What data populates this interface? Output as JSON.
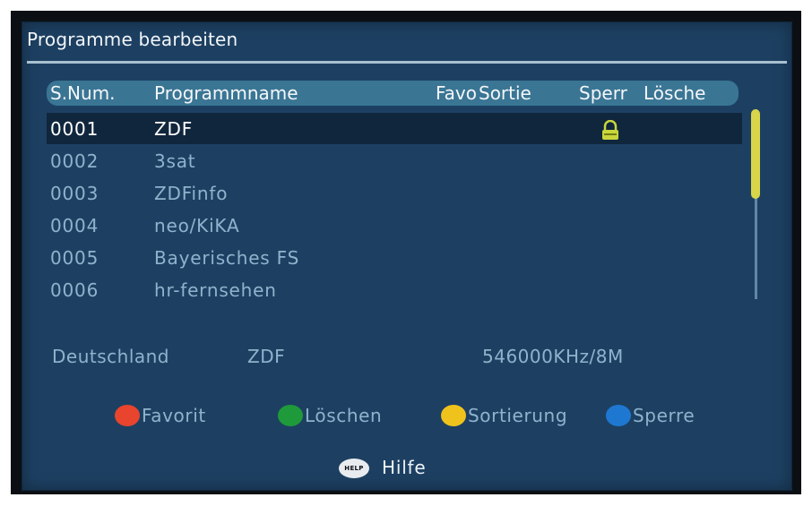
{
  "screen_title": "Programme bearbeiten",
  "columns": {
    "num": "S.Num.",
    "name": "Programmname",
    "favo": "Favo",
    "sortie": "Sortie",
    "sperr": "Sperr",
    "losche": "Lösche"
  },
  "channels": [
    {
      "num": "0001",
      "name": "ZDF",
      "locked": true,
      "selected": true
    },
    {
      "num": "0002",
      "name": "3sat",
      "locked": false,
      "selected": false
    },
    {
      "num": "0003",
      "name": "ZDFinfo",
      "locked": false,
      "selected": false
    },
    {
      "num": "0004",
      "name": "neo/KiKA",
      "locked": false,
      "selected": false
    },
    {
      "num": "0005",
      "name": "Bayerisches FS",
      "locked": false,
      "selected": false
    },
    {
      "num": "0006",
      "name": "hr-fernsehen",
      "locked": false,
      "selected": false
    }
  ],
  "info": {
    "country": "Deutschland",
    "provider": "ZDF",
    "frequency": "546000KHz/8M"
  },
  "legend": [
    {
      "label": "Favorit",
      "color": "#e8442e"
    },
    {
      "label": "Löschen",
      "color": "#1f9a3b"
    },
    {
      "label": "Sortierung",
      "color": "#f0c21c"
    },
    {
      "label": "Sperre",
      "color": "#1e78d2"
    }
  ],
  "help": {
    "button_text": "HELP",
    "label": "Hilfe"
  },
  "colors": {
    "background": "#1d4062",
    "header_bar": "#3a7594",
    "selected_row": "#10263d",
    "scroll_thumb": "#d9d54a",
    "lock_icon": "#c9d63a"
  },
  "icons": {
    "lock": "lock-icon"
  }
}
